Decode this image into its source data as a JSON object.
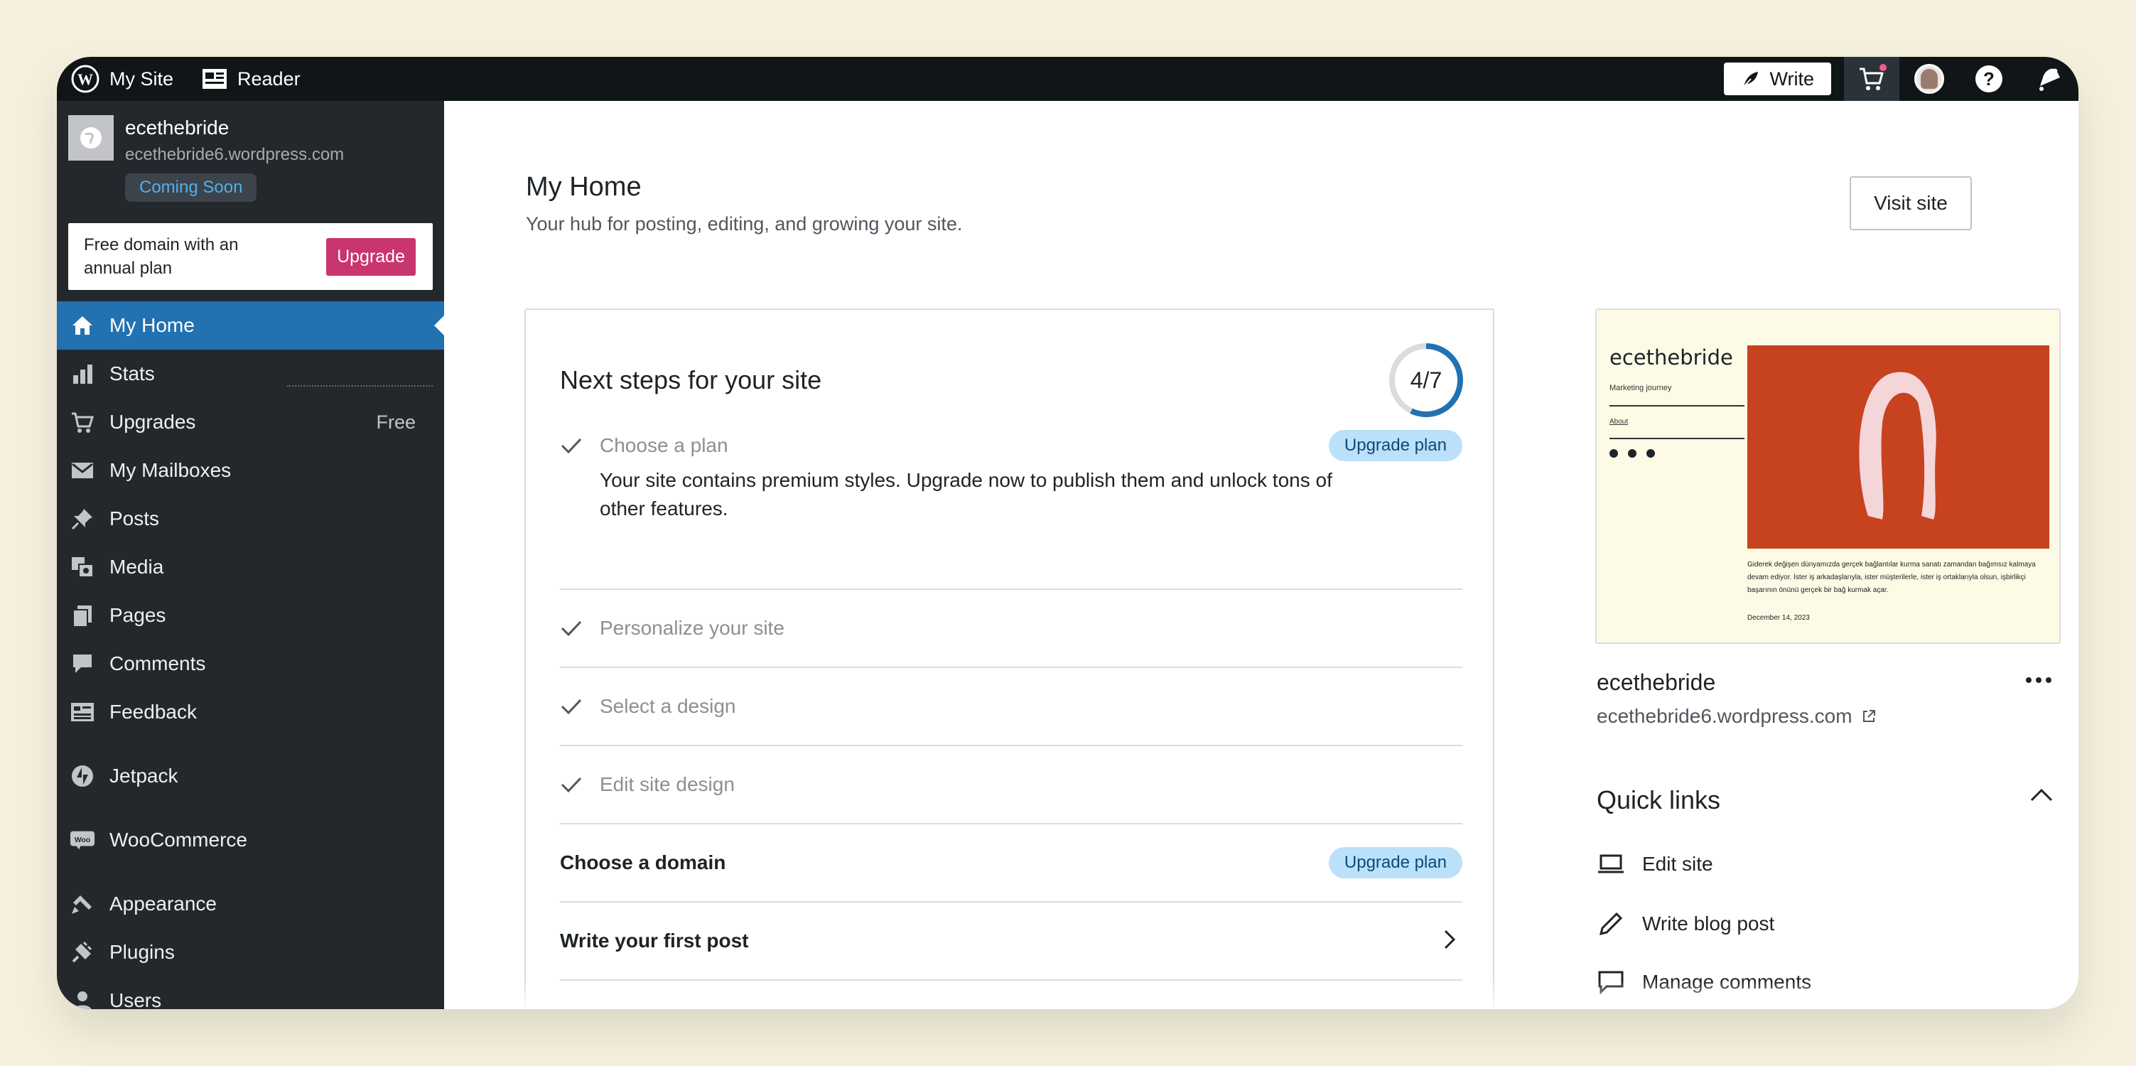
{
  "topbar": {
    "my_site": "My Site",
    "reader": "Reader",
    "write": "Write"
  },
  "sidebar": {
    "site_name": "ecethebride",
    "site_url": "ecethebride6.wordpress.com",
    "status_badge": "Coming Soon",
    "upsell_text": "Free domain with an annual plan",
    "upsell_button": "Upgrade",
    "items": [
      {
        "label": "My Home",
        "icon": "home-icon",
        "active": true
      },
      {
        "label": "Stats",
        "icon": "stats-icon"
      },
      {
        "label": "Upgrades",
        "icon": "cart-icon",
        "badge": "Free"
      },
      {
        "label": "My Mailboxes",
        "icon": "mail-icon"
      },
      {
        "label": "Posts",
        "icon": "pin-icon"
      },
      {
        "label": "Media",
        "icon": "media-icon"
      },
      {
        "label": "Pages",
        "icon": "pages-icon"
      },
      {
        "label": "Comments",
        "icon": "comment-icon"
      },
      {
        "label": "Feedback",
        "icon": "feedback-icon"
      },
      {
        "label": "Jetpack",
        "icon": "jetpack-icon"
      },
      {
        "label": "WooCommerce",
        "icon": "woo-icon"
      },
      {
        "label": "Appearance",
        "icon": "brush-icon"
      },
      {
        "label": "Plugins",
        "icon": "plugin-icon"
      },
      {
        "label": "Users",
        "icon": "users-icon"
      }
    ]
  },
  "main": {
    "title": "My Home",
    "subtitle": "Your hub for posting, editing, and growing your site.",
    "visit_site": "Visit site",
    "steps": {
      "title": "Next steps for your site",
      "progress_label": "4/7",
      "progress_fraction": 0.571,
      "tasks": [
        {
          "label": "Choose a plan",
          "done": true,
          "pill": "Upgrade plan",
          "description": "Your site contains premium styles. Upgrade now to publish them and unlock tons of other features."
        },
        {
          "label": "Personalize your site",
          "done": true
        },
        {
          "label": "Select a design",
          "done": true
        },
        {
          "label": "Edit site design",
          "done": true
        },
        {
          "label": "Choose a domain",
          "done": false,
          "pill": "Upgrade plan"
        },
        {
          "label": "Write your first post",
          "done": false
        }
      ]
    },
    "preview": {
      "site_title": "ecethebride",
      "tagline": "Marketing journey",
      "about": "About",
      "body": "Giderek değişen dünyamızda gerçek bağlantılar kurma sanatı zamandan bağımsız kalmaya devam ediyor. İster iş arkadaşlarıyla, ister müşterilerle, ister iş ortaklarıyla olsun, işbirlikçi başarının önünü gerçek bir bağ kurmak açar.",
      "date": "December 14, 2023"
    },
    "site_title": "ecethebride",
    "site_url": "ecethebride6.wordpress.com",
    "quick_links": {
      "title": "Quick links",
      "items": [
        {
          "label": "Edit site",
          "icon": "laptop-icon"
        },
        {
          "label": "Write blog post",
          "icon": "pencil-icon"
        },
        {
          "label": "Manage comments",
          "icon": "comment-outline-icon"
        }
      ]
    }
  },
  "colors": {
    "accent": "#2271b1",
    "upgrade": "#c9356e",
    "sidebar_bg": "#23282d",
    "topbar_bg": "#101517",
    "pill_bg": "#bbe0fa",
    "preview_image": "#c7421f"
  }
}
